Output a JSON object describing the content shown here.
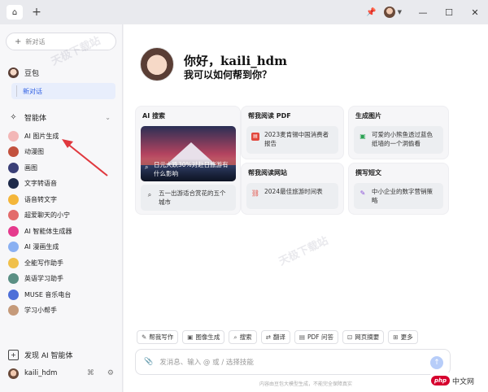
{
  "titlebar": {
    "home_icon": "home-icon",
    "add_tab": "+",
    "pin_icon": "pin-icon",
    "minimize": "—",
    "maximize": "☐",
    "close": "✕"
  },
  "sidebar": {
    "new_chat": "新对话",
    "doubao": "豆包",
    "active_chat": "新对话",
    "agents_heading": "智能体",
    "agents": [
      {
        "label": "AI 图片生成",
        "color": "#f3b7b7"
      },
      {
        "label": "动漫图",
        "color": "#c2513e"
      },
      {
        "label": "画图",
        "color": "#3a3f77"
      },
      {
        "label": "文字转语音",
        "color": "#1f2b4a"
      },
      {
        "label": "语音转文字",
        "color": "#f4b63a"
      },
      {
        "label": "超爱聊天的小宁",
        "color": "#e36b6b"
      },
      {
        "label": "AI 智能体生成器",
        "color": "#e53a8d"
      },
      {
        "label": "AI 漫画生成",
        "color": "#8ab0f2"
      },
      {
        "label": "全能写作助手",
        "color": "#f0c04b"
      },
      {
        "label": "英语学习助手",
        "color": "#5a8f84"
      },
      {
        "label": "MUSE 音乐电台",
        "color": "#4d6fd8"
      },
      {
        "label": "学习小帮手",
        "color": "#c59a7a"
      }
    ],
    "discover": "发现 AI 智能体",
    "username": "kaili_hdm"
  },
  "main": {
    "greeting_line1": "你好，kaili_hdm",
    "greeting_line2": "我可以如何帮到你？",
    "cards": {
      "search": {
        "title": "AI 搜索",
        "image_caption": "日元大跌30%对赴日旅游有什么影响",
        "item": "五一出游适合赏花的五个城市"
      },
      "read_pdf": {
        "title": "帮我阅读 PDF",
        "item": "2023麦肯锡中国消费者报告"
      },
      "gen_image": {
        "title": "生成图片",
        "item": "可爱的小熊鱼透过蓝色纸墙的一个洞偷看"
      },
      "read_web": {
        "title": "帮我阅读网站",
        "item": "2024最佳旅游时间表"
      },
      "write": {
        "title": "撰写短文",
        "item": "中小企业的数字营销策略"
      }
    },
    "tools": [
      {
        "label": "帮我写作",
        "icon": "✎"
      },
      {
        "label": "图像生成",
        "icon": "▣"
      },
      {
        "label": "搜索",
        "icon": "⌕"
      },
      {
        "label": "翻译",
        "icon": "⇄"
      },
      {
        "label": "PDF 问答",
        "icon": "▤"
      },
      {
        "label": "网页摘要",
        "icon": "⊡"
      },
      {
        "label": "更多",
        "icon": "⊞"
      }
    ],
    "input_placeholder": "发消息、输入 @ 或 / 选择技能",
    "disclaimer": "内容由豆包大模型生成，不能完全保障真实"
  },
  "watermark": "天极下载站",
  "corner_logo": {
    "badge": "php",
    "text": "中文网"
  },
  "colors": {
    "accent": "#2e5fe3",
    "arrow": "#e0383e"
  }
}
